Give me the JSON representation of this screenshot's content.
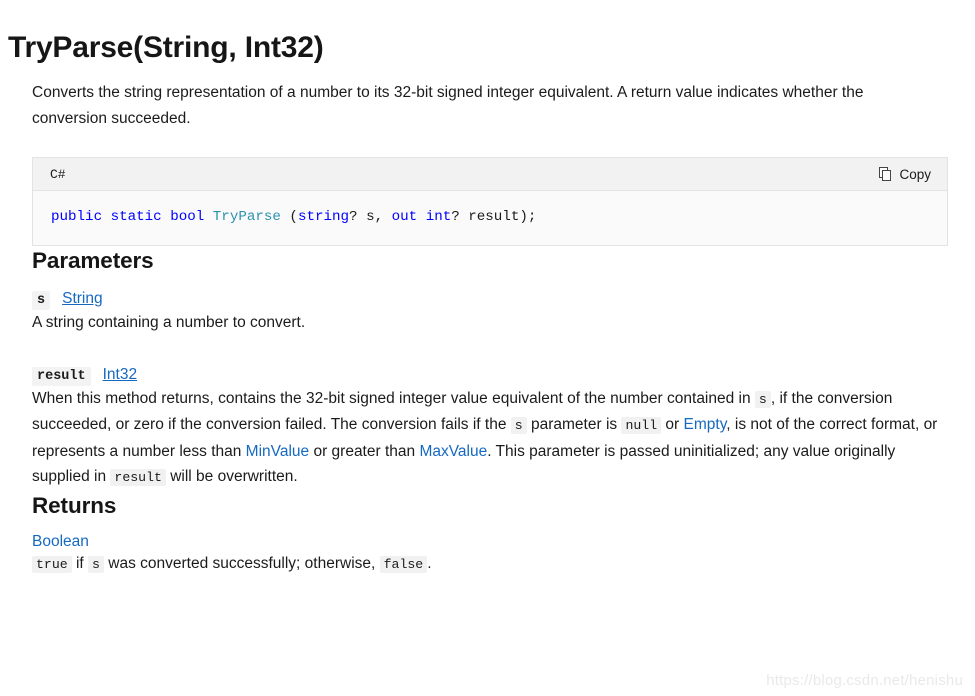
{
  "page": {
    "title": "TryParse(String, Int32)",
    "watermark": "https://blog.csdn.net/henishu"
  },
  "summary": {
    "text": "Converts the string representation of a number to its 32-bit signed integer equivalent. A return value indicates whether the conversion succeeded."
  },
  "code_block": {
    "language": "C#",
    "copy_label": "Copy",
    "copy_icon": "copy-pages-icon",
    "tokens": [
      {
        "text": "public",
        "kind": "keyword"
      },
      {
        "text": " ",
        "kind": "plain"
      },
      {
        "text": "static",
        "kind": "keyword"
      },
      {
        "text": " ",
        "kind": "plain"
      },
      {
        "text": "bool",
        "kind": "keyword"
      },
      {
        "text": " ",
        "kind": "plain"
      },
      {
        "text": "TryParse",
        "kind": "type"
      },
      {
        "text": " (",
        "kind": "plain"
      },
      {
        "text": "string",
        "kind": "keyword"
      },
      {
        "text": "? s, ",
        "kind": "plain"
      },
      {
        "text": "out",
        "kind": "keyword"
      },
      {
        "text": " ",
        "kind": "plain"
      },
      {
        "text": "int",
        "kind": "keyword"
      },
      {
        "text": "? result);",
        "kind": "plain"
      }
    ],
    "full_text": "public static bool TryParse (string? s, out int? result);"
  },
  "parameters": {
    "heading": "Parameters",
    "items": [
      {
        "name": "s",
        "type": "String",
        "description": "A string containing a number to convert."
      },
      {
        "name": "result",
        "type": "Int32",
        "description": "When this method returns, contains the 32-bit signed integer value equivalent of the number contained in s, if the conversion succeeded, or zero if the conversion failed. The conversion fails if the s parameter is null or Empty, is not of the correct format, or represents a number less than MinValue or greater than MaxValue. This parameter is passed uninitialized; any value originally supplied in result will be overwritten.",
        "description_parts": {
          "t1": "When this method returns, contains the 32-bit signed integer value equivalent of the number contained in ",
          "c1": "s",
          "t2": ", if the conversion succeeded, or zero if the conversion failed. The conversion fails if the ",
          "c2": "s",
          "t3": " parameter is ",
          "c3": "null",
          "t4": " or ",
          "l1": "Empty",
          "t5": ", is not of the correct format, or represents a number less than ",
          "l2": "MinValue",
          "t6": " or greater than ",
          "l3": "MaxValue",
          "t7": ". This parameter is passed uninitialized; any value originally supplied in ",
          "c4": "result",
          "t8": " will be overwritten."
        }
      }
    ]
  },
  "returns": {
    "heading": "Returns",
    "type": "Boolean",
    "description_parts": {
      "c1": "true",
      "t1": " if ",
      "c2": "s",
      "t2": " was converted successfully; otherwise, ",
      "c3": "false",
      "t3": "."
    },
    "description": "true if s was converted successfully; otherwise, false."
  },
  "colors": {
    "link": "#1669c1",
    "keyword": "#0000ff",
    "type": "#2b91af",
    "code_bg": "#fafafa",
    "code_header_bg": "#f2f2f2",
    "inline_code_bg": "#f1f1f1"
  }
}
